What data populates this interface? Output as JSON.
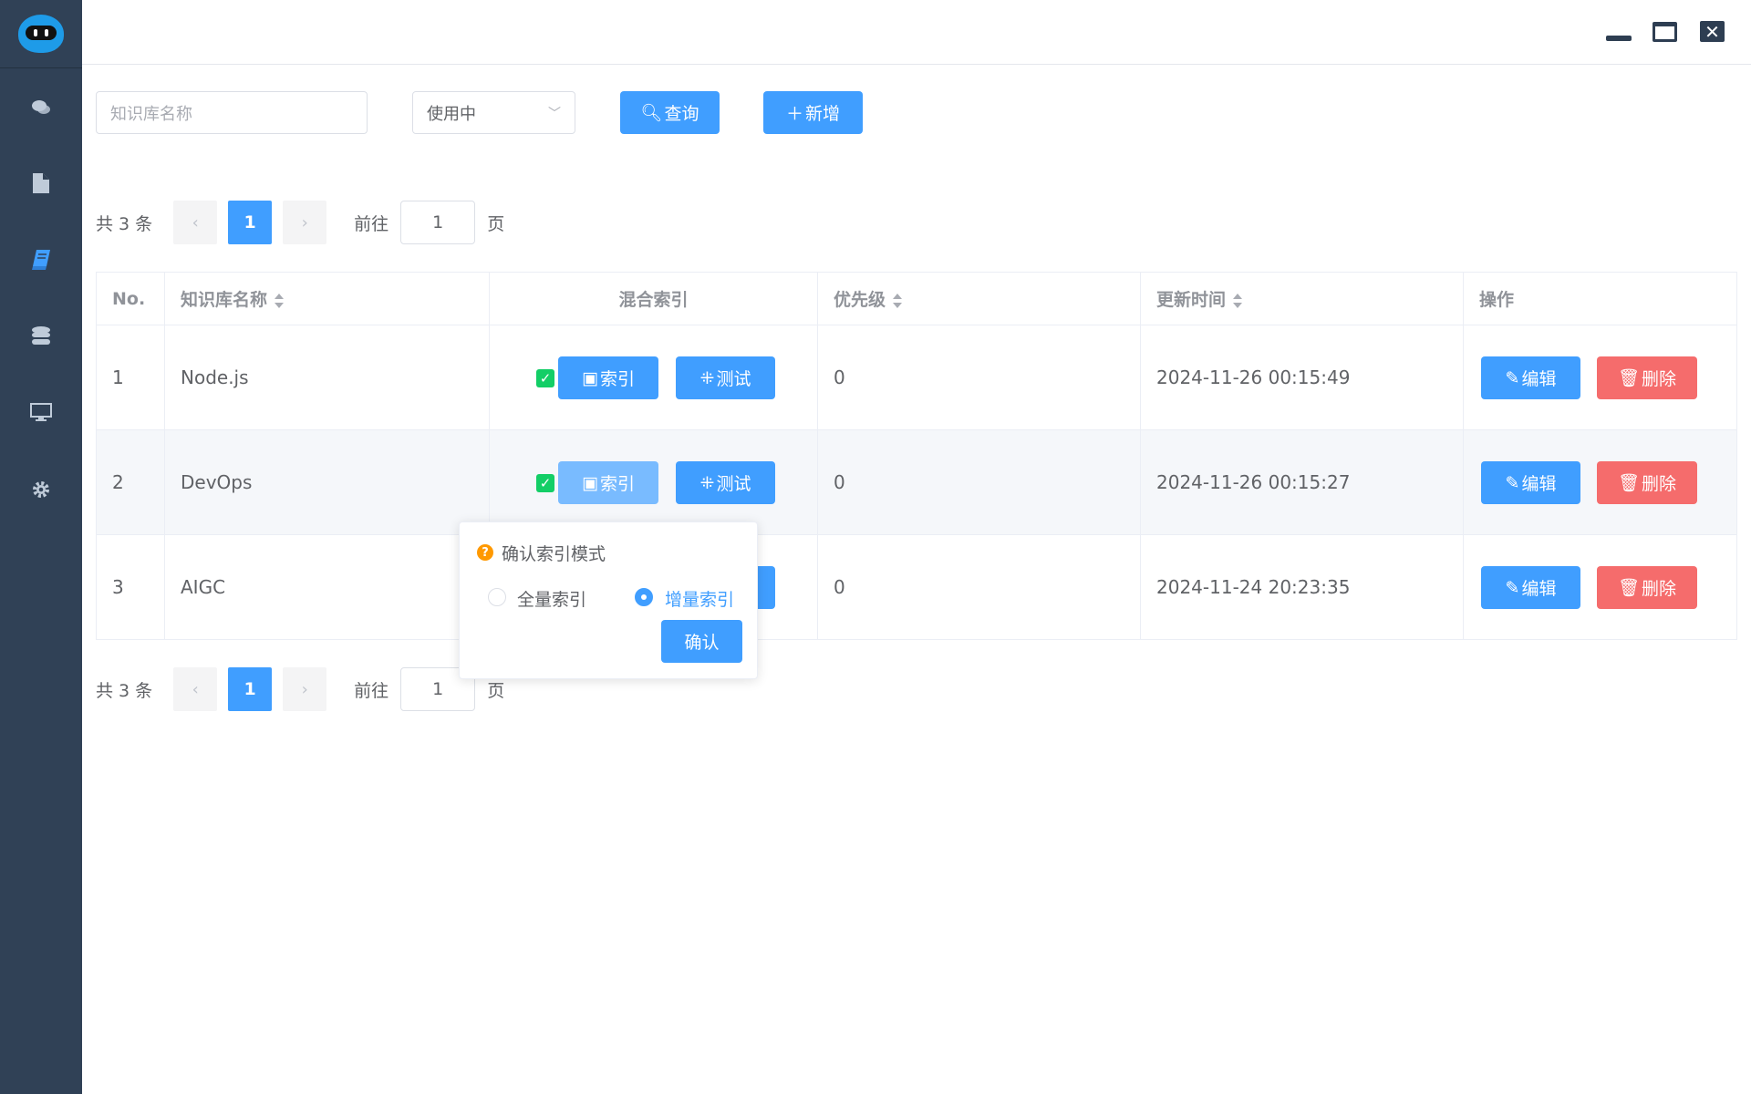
{
  "sidebar": {
    "items": [
      {
        "icon": "chat-icon",
        "active": false
      },
      {
        "icon": "document-icon",
        "active": false
      },
      {
        "icon": "book-icon",
        "active": true
      },
      {
        "icon": "database-icon",
        "active": false
      },
      {
        "icon": "monitor-icon",
        "active": false
      },
      {
        "icon": "gear-icon",
        "active": false
      }
    ]
  },
  "filters": {
    "name_placeholder": "知识库名称",
    "status_value": "使用中",
    "query_label": "查询",
    "add_label": "新增"
  },
  "pagination": {
    "total_text": "共 3 条",
    "current_page": "1",
    "goto_label": "前往",
    "goto_value": "1",
    "page_suffix": "页",
    "prev": "‹",
    "next": "›"
  },
  "table": {
    "headers": {
      "no": "No.",
      "name": "知识库名称",
      "index": "混合索引",
      "priority": "优先级",
      "updated": "更新时间",
      "actions": "操作"
    },
    "index_label": "索引",
    "test_label": "测试",
    "edit_label": "编辑",
    "delete_label": "删除",
    "rows": [
      {
        "no": "1",
        "name": "Node.js",
        "checked": true,
        "priority": "0",
        "updated": "2024-11-26 00:15:49"
      },
      {
        "no": "2",
        "name": "DevOps",
        "checked": true,
        "priority": "0",
        "updated": "2024-11-26 00:15:27"
      },
      {
        "no": "3",
        "name": "AIGC",
        "checked": true,
        "priority": "0",
        "updated": "2024-11-24 20:23:35"
      }
    ]
  },
  "popover": {
    "title": "确认索引模式",
    "option_full": "全量索引",
    "option_incremental": "增量索引",
    "selected": "增量索引",
    "confirm_label": "确认"
  },
  "colors": {
    "primary": "#409eff",
    "danger": "#f56c6c",
    "success": "#13ce66",
    "sidebar": "#304156",
    "warning": "#ff9900"
  }
}
